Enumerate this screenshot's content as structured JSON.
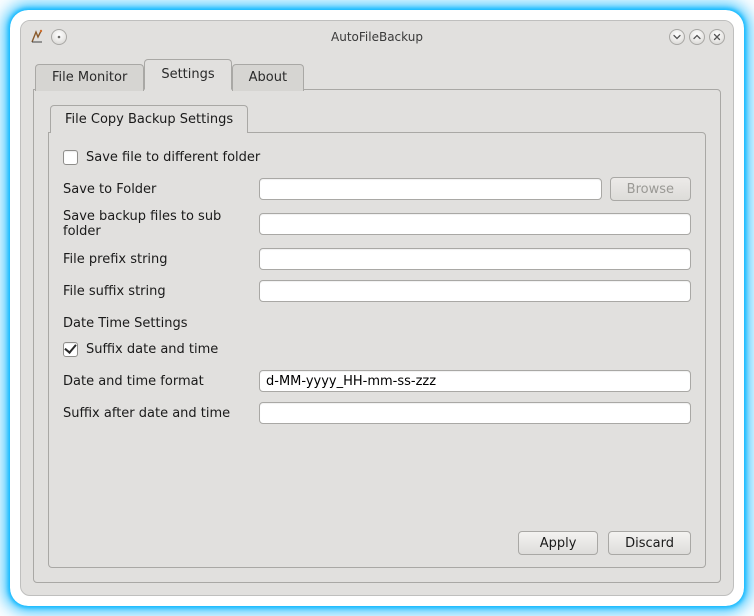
{
  "window": {
    "title": "AutoFileBackup"
  },
  "tabs": {
    "file_monitor": "File Monitor",
    "settings": "Settings",
    "about": "About"
  },
  "inner_tab": {
    "label": "File Copy Backup Settings"
  },
  "settings": {
    "save_diff_folder_label": "Save file to different folder",
    "save_diff_folder_checked": false,
    "save_to_folder_label": "Save to Folder",
    "save_to_folder_value": "",
    "browse_label": "Browse",
    "save_sub_folder_label": "Save backup files to sub folder",
    "save_sub_folder_value": "",
    "file_prefix_label": "File prefix string",
    "file_prefix_value": "",
    "file_suffix_label": "File suffix string",
    "file_suffix_value": "",
    "date_time_heading": "Date Time Settings",
    "suffix_datetime_label": "Suffix date and time",
    "suffix_datetime_checked": true,
    "datetime_format_label": "Date and time format",
    "datetime_format_value": "d-MM-yyyy_HH-mm-ss-zzz",
    "suffix_after_label": "Suffix after date and time",
    "suffix_after_value": ""
  },
  "buttons": {
    "apply": "Apply",
    "discard": "Discard"
  }
}
